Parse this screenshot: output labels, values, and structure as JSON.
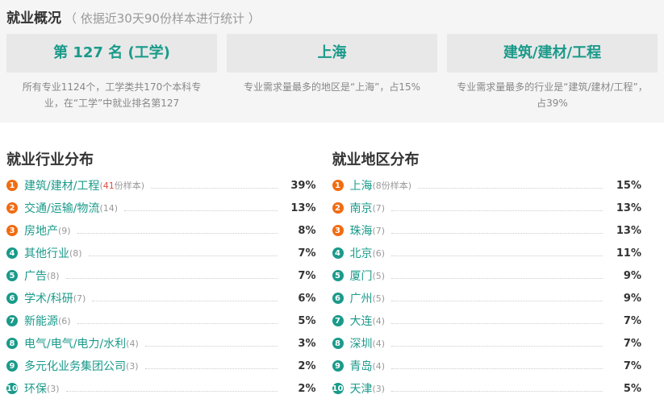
{
  "header": {
    "title": "就业概况",
    "subtitle": "（ 依据近30天90份样本进行统计 ）"
  },
  "cards": [
    {
      "value": "第 127 名 (工学)",
      "desc": "所有专业1124个，工学类共170个本科专业，在“工学”中就业排名第127"
    },
    {
      "value": "上海",
      "desc": "专业需求量最多的地区是“上海”，占15%"
    },
    {
      "value": "建筑/建材/工程",
      "desc": "专业需求量最多的行业是“建筑/建材/工程”，占39%"
    }
  ],
  "industry": {
    "title": "就业行业分布",
    "items": [
      {
        "rank": "1",
        "name": "建筑/建材/工程",
        "count": "41",
        "count_suffix": "份样本",
        "pct": "39%"
      },
      {
        "rank": "2",
        "name": "交通/运输/物流",
        "count": "(14)",
        "pct": "13%"
      },
      {
        "rank": "3",
        "name": "房地产",
        "count": "(9)",
        "pct": "8%"
      },
      {
        "rank": "4",
        "name": "其他行业",
        "count": "(8)",
        "pct": "7%"
      },
      {
        "rank": "5",
        "name": "广告",
        "count": "(8)",
        "pct": "7%"
      },
      {
        "rank": "6",
        "name": "学术/科研",
        "count": "(7)",
        "pct": "6%"
      },
      {
        "rank": "7",
        "name": "新能源",
        "count": "(6)",
        "pct": "5%"
      },
      {
        "rank": "8",
        "name": "电气/电气/电力/水利",
        "count": "(4)",
        "pct": "3%"
      },
      {
        "rank": "9",
        "name": "多元化业务集团公司",
        "count": "(3)",
        "pct": "2%"
      },
      {
        "rank": "10",
        "name": "环保",
        "count": "(3)",
        "pct": "2%"
      }
    ]
  },
  "region": {
    "title": "就业地区分布",
    "items": [
      {
        "rank": "1",
        "name": "上海",
        "count": "(8份样本)",
        "pct": "15%"
      },
      {
        "rank": "2",
        "name": "南京",
        "count": "(7)",
        "pct": "13%"
      },
      {
        "rank": "3",
        "name": "珠海",
        "count": "(7)",
        "pct": "13%"
      },
      {
        "rank": "4",
        "name": "北京",
        "count": "(6)",
        "pct": "11%"
      },
      {
        "rank": "5",
        "name": "厦门",
        "count": "(5)",
        "pct": "9%"
      },
      {
        "rank": "6",
        "name": "广州",
        "count": "(5)",
        "pct": "9%"
      },
      {
        "rank": "7",
        "name": "大连",
        "count": "(4)",
        "pct": "7%"
      },
      {
        "rank": "8",
        "name": "深圳",
        "count": "(4)",
        "pct": "7%"
      },
      {
        "rank": "9",
        "name": "青岛",
        "count": "(4)",
        "pct": "7%"
      },
      {
        "rank": "10",
        "name": "天津",
        "count": "(3)",
        "pct": "5%"
      }
    ]
  },
  "colors": {
    "accent": "#1a9a8a",
    "hot": "#f26b11",
    "highlight_count": "#e74c3c"
  }
}
